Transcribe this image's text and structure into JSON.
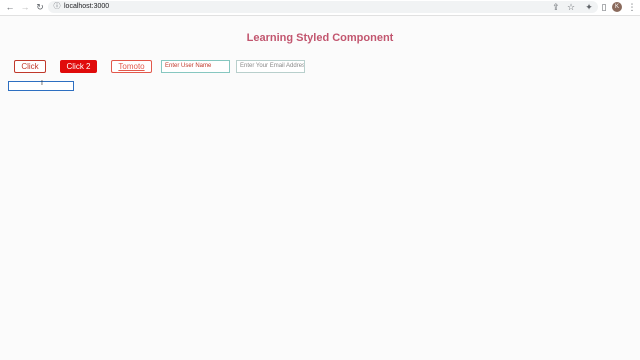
{
  "browser": {
    "url": "localhost:3000",
    "avatar_initial": "K",
    "icons": [
      "back-icon",
      "forward-icon",
      "reload-icon",
      "info-icon",
      "share-icon",
      "star-icon",
      "extensions-icon",
      "side-panel-icon",
      "menu-icon"
    ]
  },
  "page": {
    "title": "Learning Styled Component",
    "buttons": {
      "click": "Click",
      "click2": "Click 2",
      "tomato": "Tomoto"
    },
    "inputs": {
      "username_placeholder": "Enter User Name",
      "email_placeholder": "Enter Your Email Address",
      "focused_value": ""
    }
  },
  "colors": {
    "title": "#c2566f",
    "button_border": "#c0392b",
    "button_filled": "#e00b0b",
    "tomato": "#e2584b",
    "focus_ring": "#2d6fc1"
  }
}
